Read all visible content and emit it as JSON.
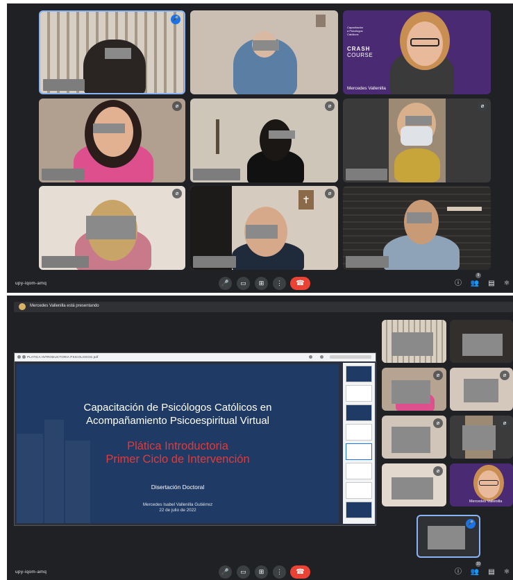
{
  "top_call": {
    "meeting_code": "upy-iqom-amq",
    "participants": [
      {
        "id": "p1",
        "mic": "speaking"
      },
      {
        "id": "p2",
        "mic": "none"
      },
      {
        "id": "p3",
        "mic": "none",
        "name": "Mercedes Vallenilla",
        "slide_background": {
          "line1": "Capacitación",
          "line2": "a Psicólogos",
          "line3": "Católicos",
          "heading1": "CRASH",
          "heading2": "COURSE"
        }
      },
      {
        "id": "p4",
        "mic": "muted"
      },
      {
        "id": "p5",
        "mic": "muted"
      },
      {
        "id": "p6",
        "mic": "muted"
      },
      {
        "id": "p7",
        "mic": "muted"
      },
      {
        "id": "p8",
        "mic": "muted"
      },
      {
        "id": "p9",
        "mic": "none"
      }
    ],
    "participant_count_badge": "9"
  },
  "bottom_call": {
    "meeting_code": "upy-iqom-amq",
    "presenting_banner": "Mercedes Vallenilla está presentando",
    "file_name": "PLATICA INTRODUCTORIA PSICOLOGOS.pdf",
    "slide": {
      "title_line1": "Capacitación de Psicólogos Católicos en",
      "title_line2": "Acompañamiento Psicoespiritual Virtual",
      "red_line1": "Plática Introductoria",
      "red_line2": "Primer Ciclo de Intervención",
      "subtitle": "Disertación Doctoral",
      "author": "Mercedes Isabel Vallenilla Gutiérrez",
      "date": "22 de julio de 2022"
    },
    "side_tile_name": "Mercedes Vallenilla",
    "participant_count_badge": "10"
  },
  "icons": {
    "mic": "🎤",
    "cam": "▭",
    "present": "⊞",
    "more": "⋮",
    "end": "☎",
    "info": "ⓘ",
    "people": "👥",
    "chat": "▤",
    "activities": "⚛"
  },
  "colors": {
    "background": "#202124",
    "end_call": "#ea4335",
    "accent": "#1a73e8",
    "slide_red": "#e23a3a",
    "slide_blue": "#1f3a64"
  }
}
